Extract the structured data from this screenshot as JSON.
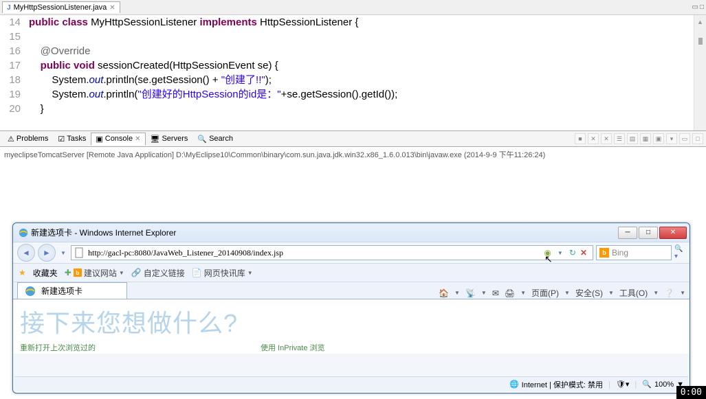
{
  "editor": {
    "tab_title": "MyHttpSessionListener.java",
    "lines": [
      14,
      15,
      16,
      17,
      18,
      19,
      20
    ]
  },
  "code": {
    "l14": {
      "kw1": "public",
      "kw2": "class",
      "cls": "MyHttpSessionListener",
      "kw3": "implements",
      "iface": "HttpSessionListener",
      "brace": " {"
    },
    "l16": {
      "ann": "@Override"
    },
    "l17": {
      "kw1": "public",
      "kw2": "void",
      "method": "sessionCreated(HttpSessionEvent se) {"
    },
    "l18": {
      "pre": "System.",
      "fld": "out",
      "mid": ".println(se.getSession() + ",
      "str": "\"创建了!!\"",
      "post": ");"
    },
    "l19": {
      "pre": "System.",
      "fld": "out",
      "mid": ".println(",
      "str": "\"创建好的HttpSession的id是：\"",
      "post": "+se.getSession().getId());"
    },
    "l20": {
      "brace": "}"
    }
  },
  "views": {
    "problems": "Problems",
    "tasks": "Tasks",
    "console": "Console",
    "servers": "Servers",
    "search": "Search"
  },
  "console_header": "myeclipseTomcatServer [Remote Java Application] D:\\MyEclipse10\\Common\\binary\\com.sun.java.jdk.win32.x86_1.6.0.013\\bin\\javaw.exe (2014-9-9 下午11:26:24)",
  "ie": {
    "title": "新建选项卡 - Windows Internet Explorer",
    "url": "http://gacl-pc:8080/JavaWeb_Listener_20140908/index.jsp",
    "bing_placeholder": "Bing",
    "favorites": "收藏夹",
    "suggest": "建议网站",
    "custom": "自定义链接",
    "quick": "网页快讯库",
    "tab_title": "新建选项卡",
    "page": "页面(P)",
    "safety": "安全(S)",
    "tools": "工具(O)",
    "big": "接下来您想做什么?",
    "green1": "重新打开上次浏览过的",
    "green2": "使用 InPrivate 浏览",
    "status_zone": "Internet | 保护模式: 禁用",
    "zoom": "100%"
  },
  "timer": "0:00"
}
